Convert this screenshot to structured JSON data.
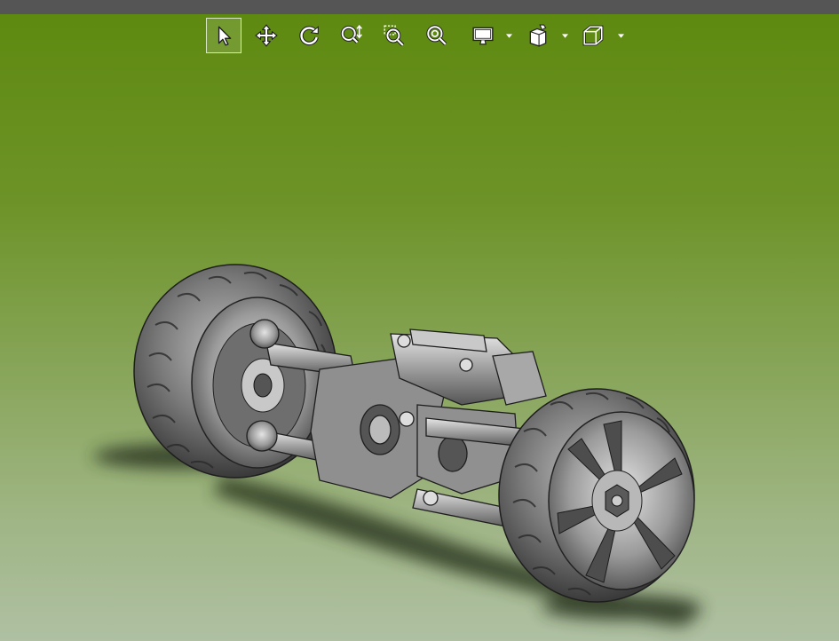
{
  "window": {
    "title_bar_color": "#555555"
  },
  "viewport": {
    "background_top": "#5e8a10",
    "background_bottom": "#afc0a3"
  },
  "toolbar": {
    "items": [
      {
        "icon": "select-arrow-icon",
        "active": true
      },
      {
        "icon": "pan-icon",
        "active": false
      },
      {
        "icon": "rotate-icon",
        "active": false
      },
      {
        "icon": "zoom-in-out-icon",
        "active": false
      },
      {
        "icon": "zoom-to-area-icon",
        "active": false
      },
      {
        "icon": "zoom-to-fit-icon",
        "active": false
      },
      {
        "icon": "display-style-icon",
        "active": false,
        "has_dropdown": true
      },
      {
        "icon": "view-settings-icon",
        "active": false,
        "has_dropdown": true
      },
      {
        "icon": "view-orientation-cube-icon",
        "active": false,
        "has_dropdown": true
      }
    ]
  },
  "model": {
    "subject": "rc-car-suspension-assembly",
    "render_color": "#8c8c8c"
  }
}
